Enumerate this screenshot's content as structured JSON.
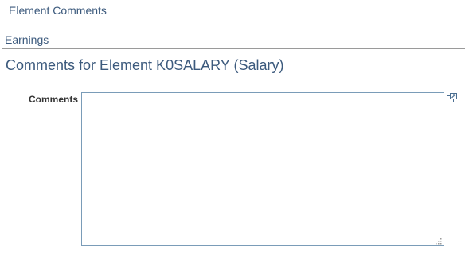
{
  "window": {
    "title": "Element Comments"
  },
  "section": {
    "label": "Earnings"
  },
  "main": {
    "heading": "Comments for Element K0SALARY (Salary)",
    "comments_label": "Comments",
    "comments_value": ""
  },
  "icons": {
    "expand": "expand-popup-icon",
    "resize": "resize-grip-icon"
  },
  "colors": {
    "title_text": "#3c5a7d",
    "field_border": "#7a9cb8"
  }
}
